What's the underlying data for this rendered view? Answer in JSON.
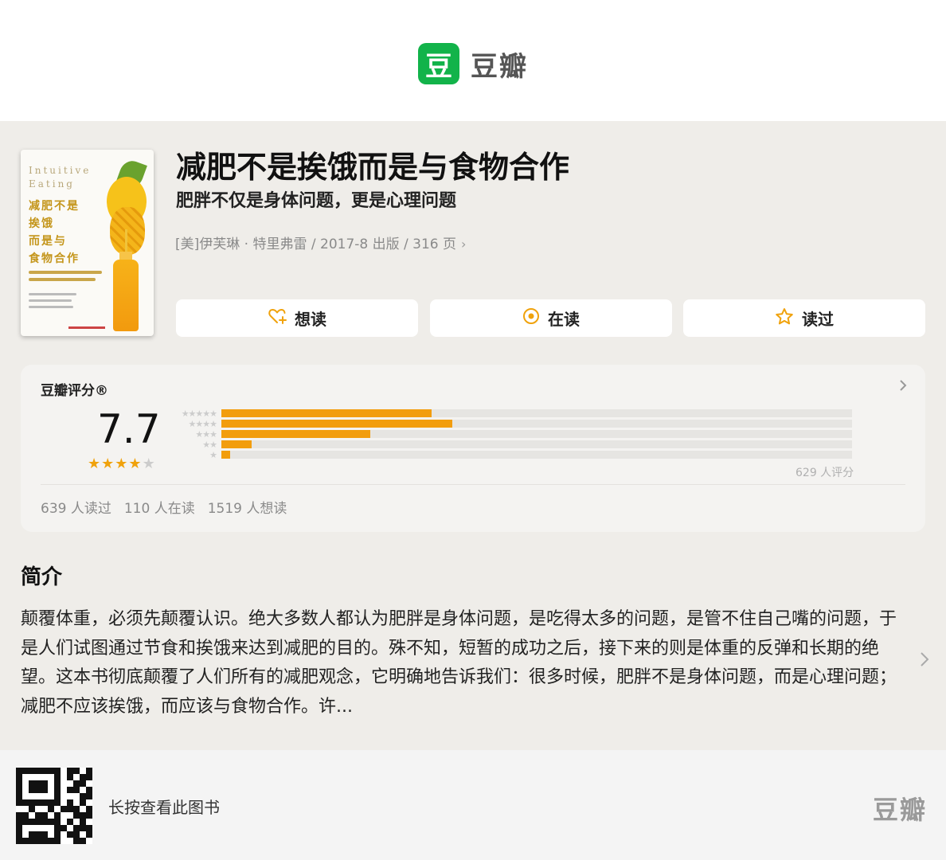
{
  "header": {
    "logo_glyph": "豆",
    "logo_text": "豆瓣"
  },
  "book": {
    "cover": {
      "en_title_line1": "Intuitive",
      "en_title_line2": "Eating",
      "cn_title_lines": [
        "减肥不是",
        "挨饿",
        "而是与",
        "食物合作"
      ]
    },
    "title": "减肥不是挨饿而是与食物合作",
    "subtitle": "肥胖不仅是身体问题，更是心理问题",
    "meta": "[美]伊芙琳 · 特里弗雷 / 2017-8 出版 / 316 页",
    "meta_chevron": "›"
  },
  "actions": {
    "want": {
      "icon": "heart-plus-icon",
      "label": "想读"
    },
    "reading": {
      "icon": "target-icon",
      "label": "在读"
    },
    "read": {
      "icon": "star-outline-icon",
      "label": "读过"
    }
  },
  "rating": {
    "label": "豆瓣评分®",
    "score": "7.7",
    "stars": 4,
    "stars_total": 5,
    "distribution": [
      {
        "stars": 5,
        "fraction": 0.333
      },
      {
        "stars": 4,
        "fraction": 0.366
      },
      {
        "stars": 3,
        "fraction": 0.236
      },
      {
        "stars": 2,
        "fraction": 0.048
      },
      {
        "stars": 1,
        "fraction": 0.014
      }
    ],
    "count_text": "629 人评分",
    "stats": [
      "639 人读过",
      "110 人在读",
      "1519 人想读"
    ],
    "accent_color": "#f29d0d"
  },
  "intro": {
    "heading": "简介",
    "text": "颠覆体重，必须先颠覆认识。绝大多数人都认为肥胖是身体问题，是吃得太多的问题，是管不住自己嘴的问题，于是人们试图通过节食和挨饿来达到减肥的目的。殊不知，短暂的成功之后，接下来的则是体重的反弹和长期的绝望。这本书彻底颠覆了人们所有的减肥观念，它明确地告诉我们：很多时候，肥胖不是身体问题，而是心理问题；减肥不应该挨饿，而应该与食物合作。许..."
  },
  "footer": {
    "hint": "长按查看此图书",
    "logo_text": "豆瓣"
  }
}
